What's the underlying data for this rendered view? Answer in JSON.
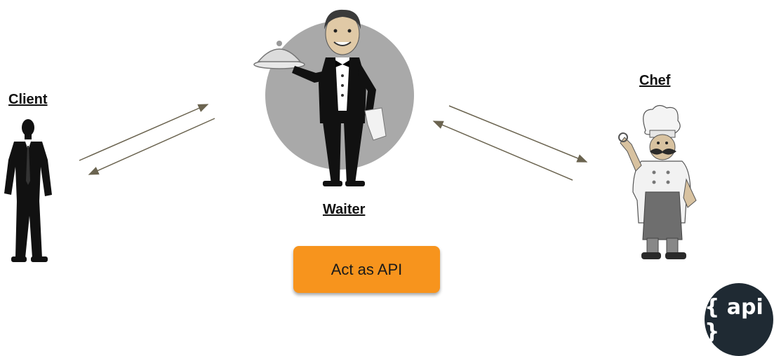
{
  "labels": {
    "client": "Client",
    "waiter": "Waiter",
    "chef": "Chef"
  },
  "api_button": {
    "label": "Act as API"
  },
  "logo": {
    "text": "{ api }"
  },
  "figures": {
    "client": "businessman-silhouette-icon",
    "waiter": "waiter-with-cloche-icon",
    "chef": "chef-ok-gesture-icon"
  },
  "colors": {
    "button": "#f7941d",
    "arrow": "#6b6450",
    "logo_bg": "#1f2a33"
  }
}
